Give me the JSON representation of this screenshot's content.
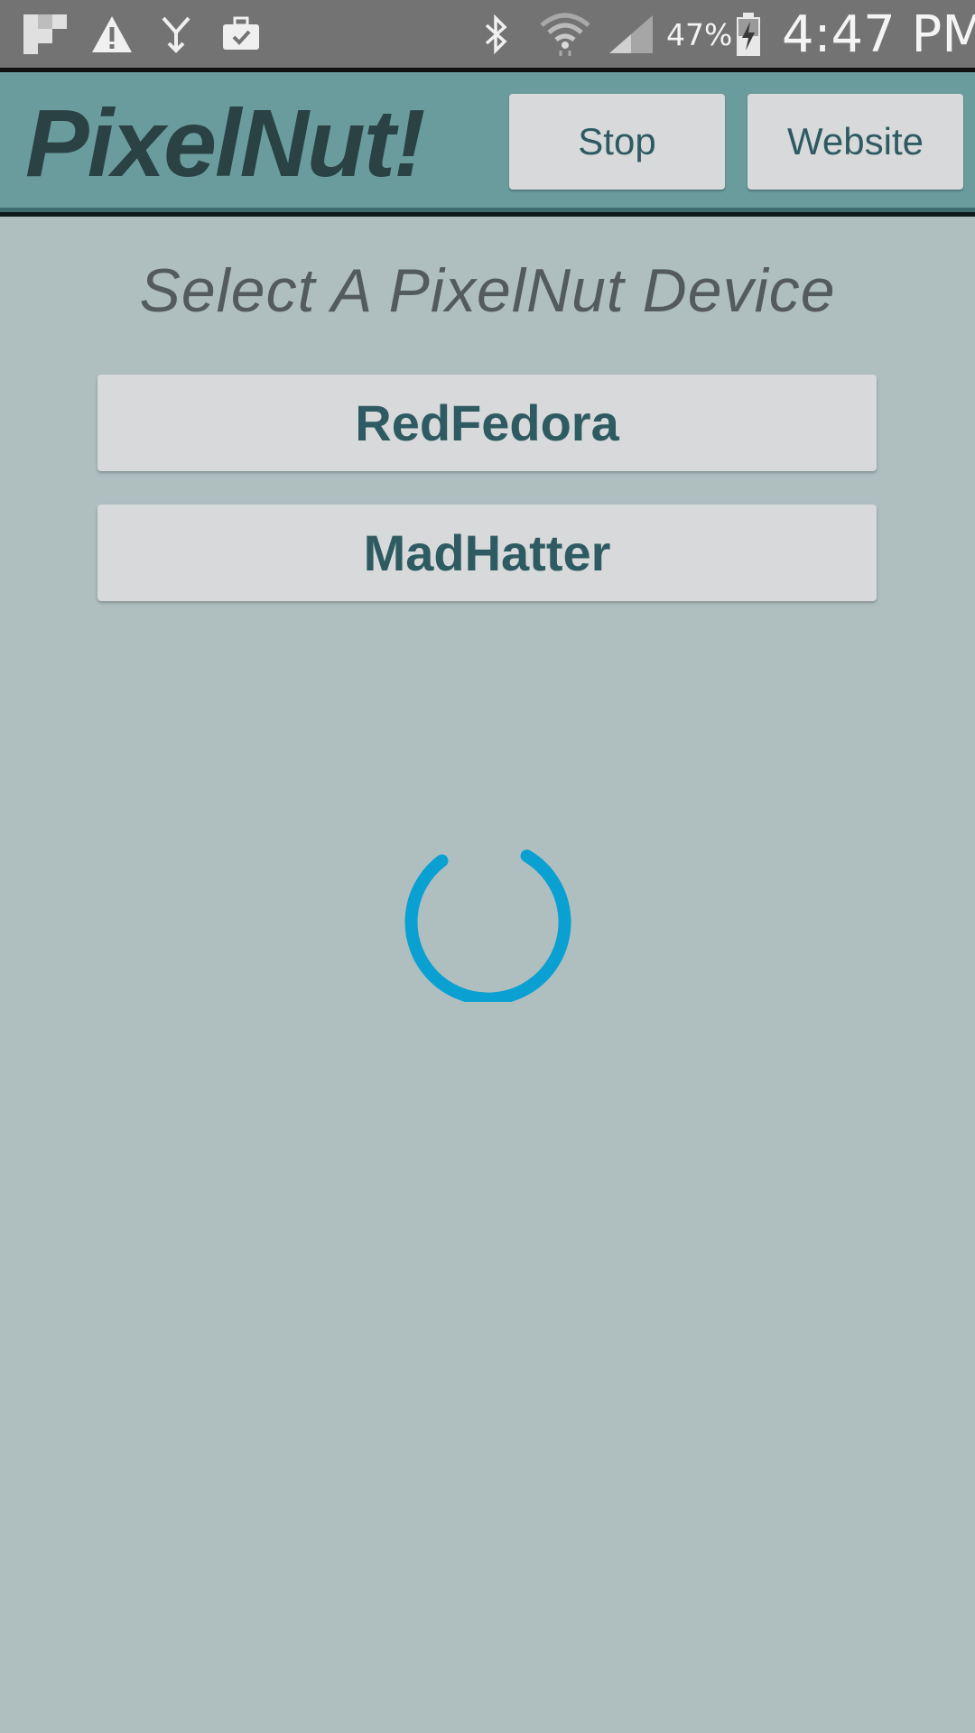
{
  "status_bar": {
    "icons_left": [
      "flipboard-icon",
      "warning-icon",
      "usb-icon",
      "briefcase-icon"
    ],
    "icons_right": [
      "bluetooth-icon",
      "wifi-icon",
      "signal-icon",
      "battery-charging-icon"
    ],
    "battery_percent": "47%",
    "time": "4:47 PM"
  },
  "app_bar": {
    "title": "PixelNut!",
    "stop_label": "Stop",
    "website_label": "Website"
  },
  "main": {
    "heading": "Select A PixelNut Device",
    "devices": [
      "RedFedora",
      "MadHatter"
    ],
    "spinner_color": "#0aa0d2"
  },
  "colors": {
    "status_bar_bg": "#737373",
    "app_bar_bg": "#6a9c9e",
    "page_bg": "#afbfc0",
    "button_bg": "#d8d9da",
    "button_text": "#2e5b62",
    "title_text": "#2a4244"
  }
}
